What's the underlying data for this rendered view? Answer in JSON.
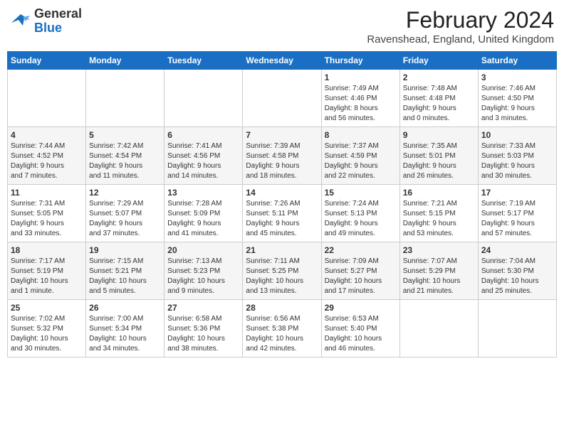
{
  "logo": {
    "line1": "General",
    "line2": "Blue"
  },
  "title": "February 2024",
  "subtitle": "Ravenshead, England, United Kingdom",
  "days_header": [
    "Sunday",
    "Monday",
    "Tuesday",
    "Wednesday",
    "Thursday",
    "Friday",
    "Saturday"
  ],
  "weeks": [
    [
      {
        "num": "",
        "info": ""
      },
      {
        "num": "",
        "info": ""
      },
      {
        "num": "",
        "info": ""
      },
      {
        "num": "",
        "info": ""
      },
      {
        "num": "1",
        "info": "Sunrise: 7:49 AM\nSunset: 4:46 PM\nDaylight: 8 hours\nand 56 minutes."
      },
      {
        "num": "2",
        "info": "Sunrise: 7:48 AM\nSunset: 4:48 PM\nDaylight: 9 hours\nand 0 minutes."
      },
      {
        "num": "3",
        "info": "Sunrise: 7:46 AM\nSunset: 4:50 PM\nDaylight: 9 hours\nand 3 minutes."
      }
    ],
    [
      {
        "num": "4",
        "info": "Sunrise: 7:44 AM\nSunset: 4:52 PM\nDaylight: 9 hours\nand 7 minutes."
      },
      {
        "num": "5",
        "info": "Sunrise: 7:42 AM\nSunset: 4:54 PM\nDaylight: 9 hours\nand 11 minutes."
      },
      {
        "num": "6",
        "info": "Sunrise: 7:41 AM\nSunset: 4:56 PM\nDaylight: 9 hours\nand 14 minutes."
      },
      {
        "num": "7",
        "info": "Sunrise: 7:39 AM\nSunset: 4:58 PM\nDaylight: 9 hours\nand 18 minutes."
      },
      {
        "num": "8",
        "info": "Sunrise: 7:37 AM\nSunset: 4:59 PM\nDaylight: 9 hours\nand 22 minutes."
      },
      {
        "num": "9",
        "info": "Sunrise: 7:35 AM\nSunset: 5:01 PM\nDaylight: 9 hours\nand 26 minutes."
      },
      {
        "num": "10",
        "info": "Sunrise: 7:33 AM\nSunset: 5:03 PM\nDaylight: 9 hours\nand 30 minutes."
      }
    ],
    [
      {
        "num": "11",
        "info": "Sunrise: 7:31 AM\nSunset: 5:05 PM\nDaylight: 9 hours\nand 33 minutes."
      },
      {
        "num": "12",
        "info": "Sunrise: 7:29 AM\nSunset: 5:07 PM\nDaylight: 9 hours\nand 37 minutes."
      },
      {
        "num": "13",
        "info": "Sunrise: 7:28 AM\nSunset: 5:09 PM\nDaylight: 9 hours\nand 41 minutes."
      },
      {
        "num": "14",
        "info": "Sunrise: 7:26 AM\nSunset: 5:11 PM\nDaylight: 9 hours\nand 45 minutes."
      },
      {
        "num": "15",
        "info": "Sunrise: 7:24 AM\nSunset: 5:13 PM\nDaylight: 9 hours\nand 49 minutes."
      },
      {
        "num": "16",
        "info": "Sunrise: 7:21 AM\nSunset: 5:15 PM\nDaylight: 9 hours\nand 53 minutes."
      },
      {
        "num": "17",
        "info": "Sunrise: 7:19 AM\nSunset: 5:17 PM\nDaylight: 9 hours\nand 57 minutes."
      }
    ],
    [
      {
        "num": "18",
        "info": "Sunrise: 7:17 AM\nSunset: 5:19 PM\nDaylight: 10 hours\nand 1 minute."
      },
      {
        "num": "19",
        "info": "Sunrise: 7:15 AM\nSunset: 5:21 PM\nDaylight: 10 hours\nand 5 minutes."
      },
      {
        "num": "20",
        "info": "Sunrise: 7:13 AM\nSunset: 5:23 PM\nDaylight: 10 hours\nand 9 minutes."
      },
      {
        "num": "21",
        "info": "Sunrise: 7:11 AM\nSunset: 5:25 PM\nDaylight: 10 hours\nand 13 minutes."
      },
      {
        "num": "22",
        "info": "Sunrise: 7:09 AM\nSunset: 5:27 PM\nDaylight: 10 hours\nand 17 minutes."
      },
      {
        "num": "23",
        "info": "Sunrise: 7:07 AM\nSunset: 5:29 PM\nDaylight: 10 hours\nand 21 minutes."
      },
      {
        "num": "24",
        "info": "Sunrise: 7:04 AM\nSunset: 5:30 PM\nDaylight: 10 hours\nand 25 minutes."
      }
    ],
    [
      {
        "num": "25",
        "info": "Sunrise: 7:02 AM\nSunset: 5:32 PM\nDaylight: 10 hours\nand 30 minutes."
      },
      {
        "num": "26",
        "info": "Sunrise: 7:00 AM\nSunset: 5:34 PM\nDaylight: 10 hours\nand 34 minutes."
      },
      {
        "num": "27",
        "info": "Sunrise: 6:58 AM\nSunset: 5:36 PM\nDaylight: 10 hours\nand 38 minutes."
      },
      {
        "num": "28",
        "info": "Sunrise: 6:56 AM\nSunset: 5:38 PM\nDaylight: 10 hours\nand 42 minutes."
      },
      {
        "num": "29",
        "info": "Sunrise: 6:53 AM\nSunset: 5:40 PM\nDaylight: 10 hours\nand 46 minutes."
      },
      {
        "num": "",
        "info": ""
      },
      {
        "num": "",
        "info": ""
      }
    ]
  ]
}
